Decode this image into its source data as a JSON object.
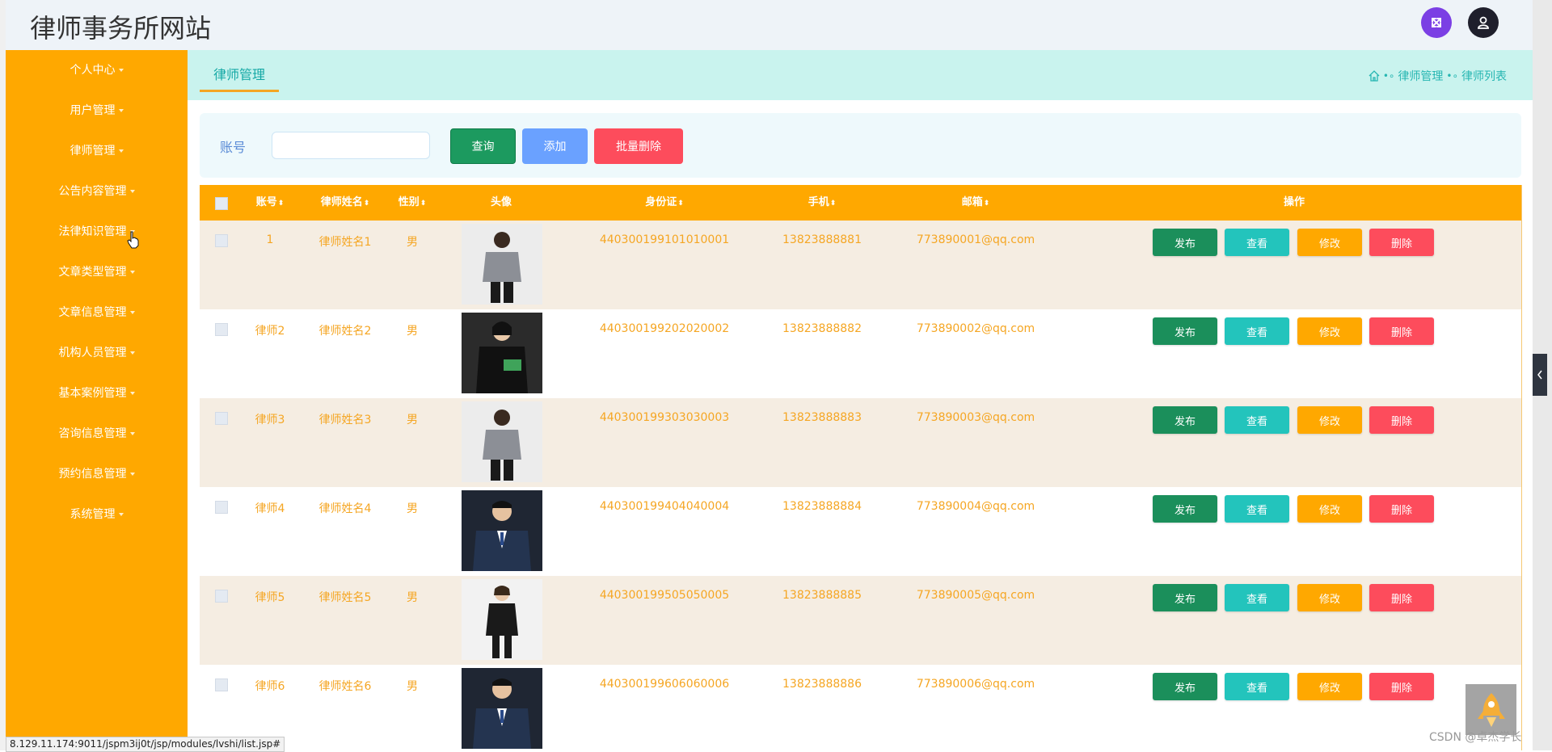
{
  "header": {
    "title": "律师事务所网站"
  },
  "colors": {
    "sidebar_bg": "#ffa800",
    "accent": "#14a8a5",
    "table_text": "#f5a623",
    "publish": "#1b8f5b",
    "view": "#23c4bc",
    "edit": "#ffa800",
    "delete": "#fd4c5c"
  },
  "sidebar": {
    "items": [
      {
        "label": "个人中心"
      },
      {
        "label": "用户管理"
      },
      {
        "label": "律师管理"
      },
      {
        "label": "公告内容管理"
      },
      {
        "label": "法律知识管理"
      },
      {
        "label": "文章类型管理"
      },
      {
        "label": "文章信息管理"
      },
      {
        "label": "机构人员管理"
      },
      {
        "label": "基本案例管理"
      },
      {
        "label": "咨询信息管理"
      },
      {
        "label": "预约信息管理"
      },
      {
        "label": "系统管理"
      }
    ]
  },
  "tabs": [
    {
      "label": "律师管理"
    }
  ],
  "breadcrumb": {
    "items": [
      "律师管理",
      "律师列表"
    ],
    "home_icon": "home-icon",
    "separator_icon": "dot-chain-icon"
  },
  "search": {
    "label": "账号",
    "value": "",
    "placeholder": "",
    "search_button": "查询",
    "add_button": "添加",
    "batch_delete_button": "批量删除"
  },
  "table": {
    "columns": [
      {
        "label": "账号",
        "sortable": true
      },
      {
        "label": "律师姓名",
        "sortable": true
      },
      {
        "label": "性别",
        "sortable": true
      },
      {
        "label": "头像",
        "sortable": false
      },
      {
        "label": "身份证",
        "sortable": true
      },
      {
        "label": "手机",
        "sortable": true
      },
      {
        "label": "邮箱",
        "sortable": true
      },
      {
        "label": "操作",
        "sortable": false
      }
    ],
    "sort_icon": "⬍",
    "action_labels": {
      "publish": "发布",
      "view": "查看",
      "edit": "修改",
      "delete": "删除"
    },
    "rows": [
      {
        "account": "1",
        "name": "律师姓名1",
        "gender": "男",
        "id_card": "440300199101010001",
        "phone": "13823888881",
        "email": "773890001@qq.com",
        "avatar": "male-gray-jacket"
      },
      {
        "account": "律师2",
        "name": "律师姓名2",
        "gender": "男",
        "id_card": "440300199202020002",
        "phone": "13823888882",
        "email": "773890002@qq.com",
        "avatar": "female-black-green"
      },
      {
        "account": "律师3",
        "name": "律师姓名3",
        "gender": "男",
        "id_card": "440300199303030003",
        "phone": "13823888883",
        "email": "773890003@qq.com",
        "avatar": "male-gray-jacket"
      },
      {
        "account": "律师4",
        "name": "律师姓名4",
        "gender": "男",
        "id_card": "440300199404040004",
        "phone": "13823888884",
        "email": "773890004@qq.com",
        "avatar": "male-navy-suit"
      },
      {
        "account": "律师5",
        "name": "律师姓名5",
        "gender": "男",
        "id_card": "440300199505050005",
        "phone": "13823888885",
        "email": "773890005@qq.com",
        "avatar": "female-black-suit"
      },
      {
        "account": "律师6",
        "name": "律师姓名6",
        "gender": "男",
        "id_card": "440300199606060006",
        "phone": "13823888886",
        "email": "773890006@qq.com",
        "avatar": "male-navy-suit"
      }
    ]
  },
  "status_bar": {
    "url": "8.129.11.174:9011/jspm3ij0t/jsp/modules/lvshi/list.jsp#"
  },
  "watermark": "CSDN @卓杰学长"
}
